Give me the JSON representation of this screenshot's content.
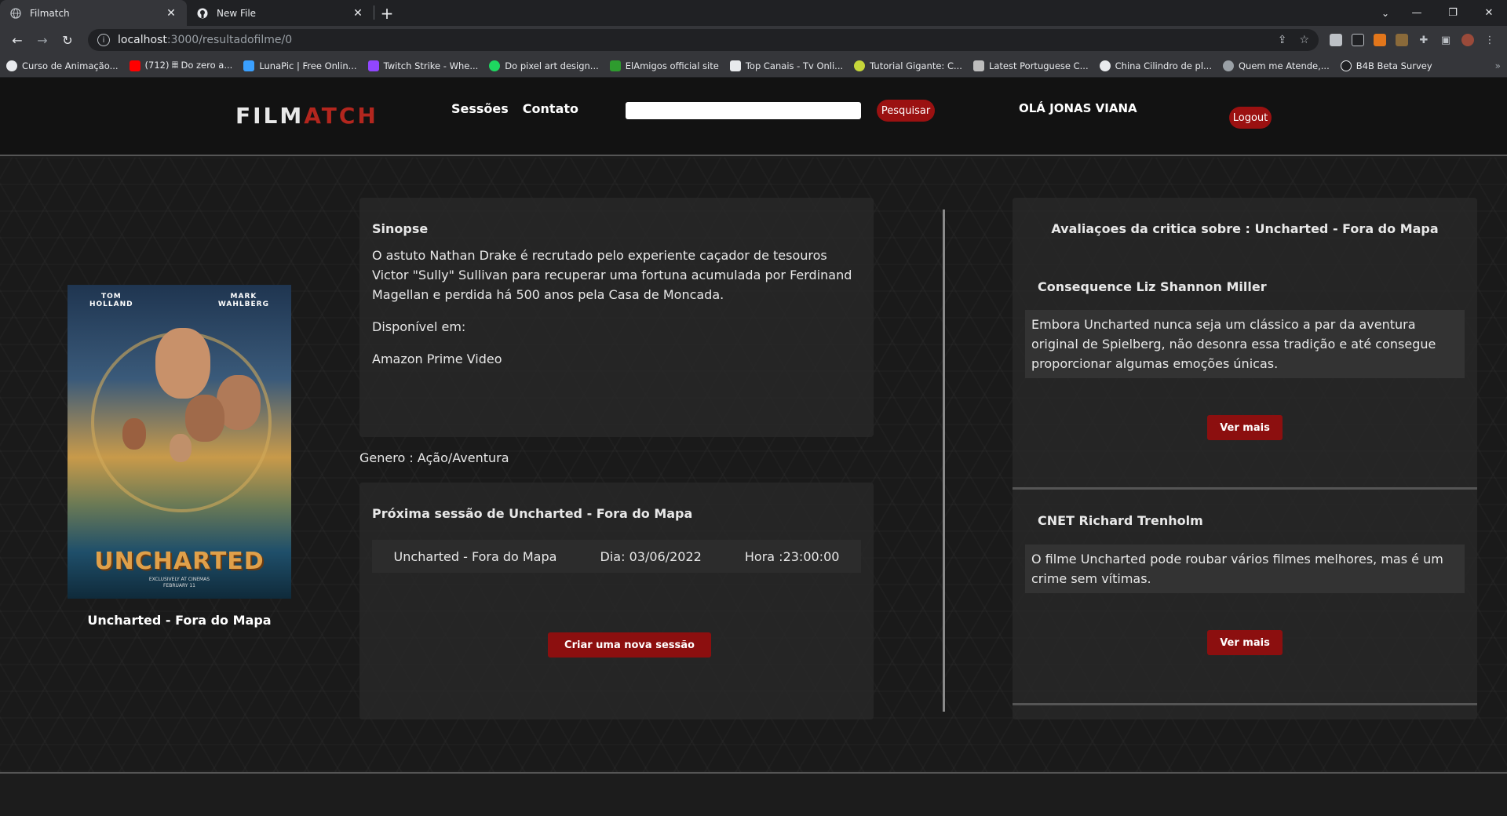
{
  "browser": {
    "tabs": [
      {
        "title": "Filmatch",
        "active": true
      },
      {
        "title": "New File",
        "active": false
      }
    ],
    "new_tab": "+",
    "url_host": "localhost",
    "url_path": ":3000/resultadofilme/0",
    "bookmarks": [
      {
        "label": "Curso de Animação...",
        "color": "#e8eaed"
      },
      {
        "label": "(712) 𝄜 Do zero a...",
        "color": "#ff0000"
      },
      {
        "label": "LunaPic | Free Onlin...",
        "color": "#3aa0ff"
      },
      {
        "label": "Twitch Strike - Whe...",
        "color": "#9146ff"
      },
      {
        "label": "Do pixel art design...",
        "color": "#1ed760"
      },
      {
        "label": "ElAmigos official site",
        "color": "#2e9b2e"
      },
      {
        "label": "Top Canais - Tv Onli...",
        "color": "#e8eaed"
      },
      {
        "label": "Tutorial Gigante: C...",
        "color": "#c6d63a"
      },
      {
        "label": "Latest Portuguese C...",
        "color": "#bdbdbd"
      },
      {
        "label": "China Cilindro de pl...",
        "color": "#e8eaed"
      },
      {
        "label": "Quem me Atende,...",
        "color": "#9aa0a6"
      },
      {
        "label": "B4B Beta Survey",
        "color": "#202124"
      }
    ],
    "bookmarks_more": "»"
  },
  "header": {
    "logo_part1": "FILM",
    "logo_part2": "ATCH",
    "nav": [
      "Sessões",
      "Contato"
    ],
    "search_button": "Pesquisar",
    "greeting": "OLÁ JONAS VIANA",
    "logout": "Logout"
  },
  "movie": {
    "poster_names": [
      "TOM\nHOLLAND",
      "MARK\nWAHLBERG"
    ],
    "poster_title": "UNCHARTED",
    "poster_footnote": "EXCLUSIVELY AT CINEMAS\nFEBRUARY 11",
    "caption": "Uncharted - Fora do Mapa"
  },
  "synopsis": {
    "title": "Sinopse",
    "text": "O astuto Nathan Drake é recrutado pelo experiente caçador de tesouros Victor \"Sully\" Sullivan para recuperar uma fortuna acumulada por Ferdinand Magellan e perdida há 500 anos pela Casa de Moncada.",
    "available_label": "Disponível em:",
    "available_value": "Amazon Prime Video"
  },
  "genre": "Genero : Ação/Aventura",
  "session": {
    "title": "Próxima sessão de Uncharted - Fora do Mapa",
    "movie": "Uncharted - Fora do Mapa",
    "day": "Dia: 03/06/2022",
    "time": "Hora :23:00:00",
    "create_button": "Criar uma nova sessão"
  },
  "reviews": {
    "title": "Avaliaçoes da critica sobre : Uncharted - Fora do Mapa",
    "items": [
      {
        "critic": "Consequence Liz Shannon Miller",
        "quote": "Embora Uncharted nunca seja um clássico a par da aventura original de Spielberg, não desonra essa tradição e até consegue proporcionar algumas emoções únicas.",
        "button": "Ver mais"
      },
      {
        "critic": "CNET Richard Trenholm",
        "quote": "O filme Uncharted pode roubar vários filmes melhores, mas é um crime sem vítimas.",
        "button": "Ver mais"
      }
    ]
  }
}
